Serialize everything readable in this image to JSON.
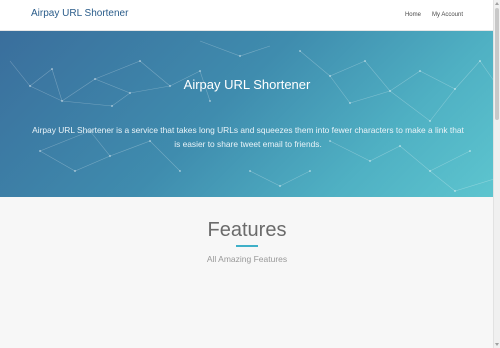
{
  "navbar": {
    "brand": "Airpay URL Shortener",
    "links": [
      {
        "label": "Home"
      },
      {
        "label": "My Account"
      }
    ]
  },
  "hero": {
    "title": "Airpay URL Shortener",
    "description": "Airpay URL Shortener is a service that takes long URLs and squeezes them into fewer characters to make a link that is easier to share tweet email to friends."
  },
  "features": {
    "title": "Features",
    "subtitle": "All Amazing Features"
  },
  "colors": {
    "brand_text": "#2a5c8a",
    "hero_gradient_start": "#3a6e9c",
    "hero_gradient_end": "#5dc5cf",
    "accent": "#3fb0c8"
  }
}
